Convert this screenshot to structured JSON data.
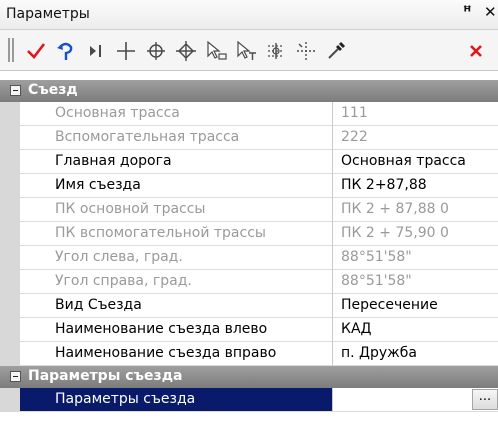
{
  "window": {
    "title": "Параметры"
  },
  "toolbar": {
    "icons": [
      "grip-icon",
      "checkmark-icon",
      "undo-arrow-icon",
      "step-icon",
      "crosshair-plus-icon",
      "circle-crosshair-icon",
      "diamond-crosshair-icon",
      "arrow-select-icon",
      "arrow-select-t-icon",
      "snap-grid-icon",
      "dotted-cross-icon",
      "eyedropper-icon",
      "close-icon"
    ],
    "colors": {
      "check": "#e0161c",
      "undo": "#1650c8",
      "close": "#e0161c",
      "icon": "#4a4a4a"
    }
  },
  "grid": {
    "categories": [
      {
        "label": "Съезд"
      },
      {
        "label": "Параметры съезда"
      }
    ],
    "rows": [
      {
        "name": "Основная трасса",
        "value": "111",
        "readonly": true
      },
      {
        "name": "Вспомогательная трасса",
        "value": "222",
        "readonly": true
      },
      {
        "name": "Главная дорога",
        "value": "Основная трасса",
        "readonly": false
      },
      {
        "name": "Имя съезда",
        "value": "ПК 2+87,88",
        "readonly": false
      },
      {
        "name": "ПК основной трассы",
        "value": "ПК    2 + 87,88  0",
        "readonly": true
      },
      {
        "name": "ПК вспомогательной трассы",
        "value": "ПК    2 + 75,90  0",
        "readonly": true
      },
      {
        "name": "Угол слева, град.",
        "value": "  88°51'58\"",
        "readonly": true
      },
      {
        "name": "Угол справа, град.",
        "value": "  88°51'58\"",
        "readonly": true
      },
      {
        "name": "Вид Съезда",
        "value": "Пересечение",
        "readonly": false
      },
      {
        "name": "Наименование съезда влево",
        "value": "КАД",
        "readonly": false
      },
      {
        "name": "Наименование съезда вправо",
        "value": "п. Дружба",
        "readonly": false
      },
      {
        "name": "Параметры съезда",
        "value": "",
        "readonly": false,
        "selected": true,
        "button": "..."
      }
    ],
    "colors": {
      "category_bg": "#8c8c8c",
      "selected_bg": "#0a1a6a",
      "readonly_text": "#9a9a9a"
    }
  }
}
